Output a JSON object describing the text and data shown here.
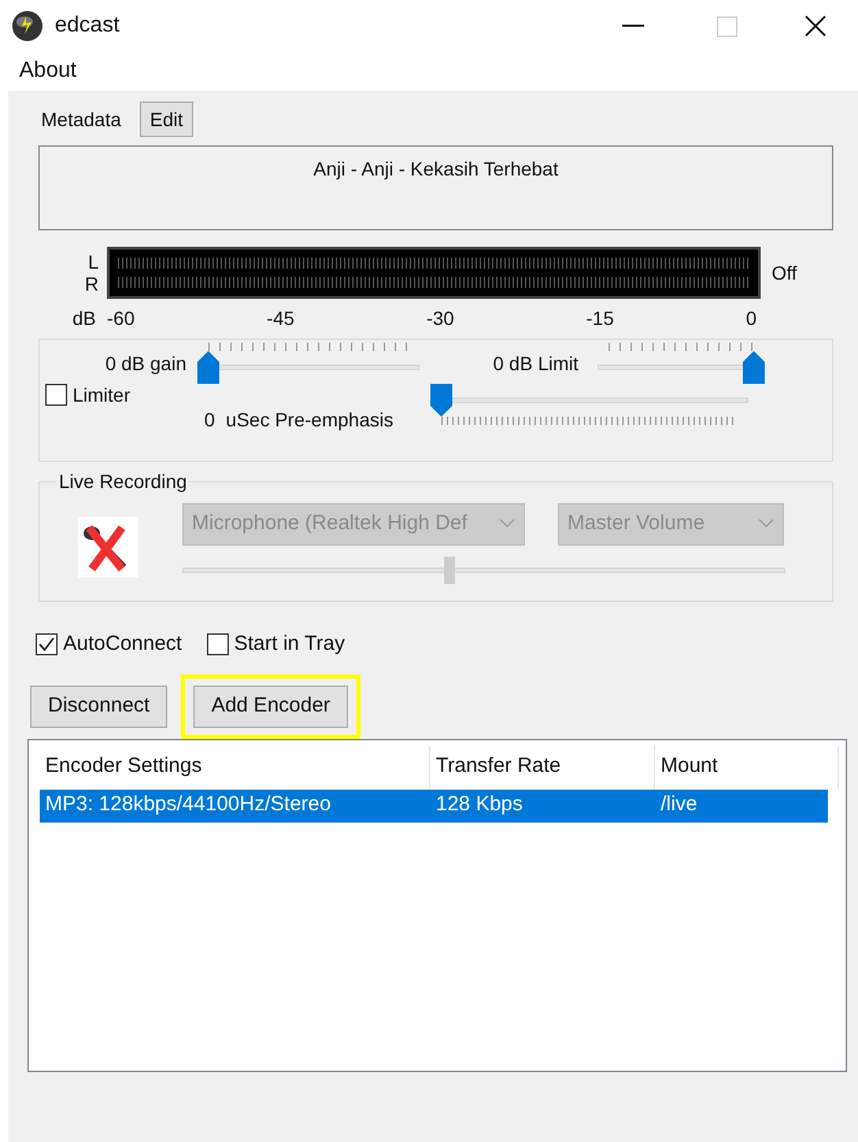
{
  "window": {
    "title": "edcast"
  },
  "menu": [
    "About"
  ],
  "metadata": {
    "label": "Metadata",
    "edit_button": "Edit",
    "value": "Anji - Anji - Kekasih Terhebat"
  },
  "meter": {
    "channels": [
      "L",
      "R"
    ],
    "status": "Off",
    "scale_unit": "dB",
    "scale": [
      "-60",
      "-45",
      "-30",
      "-15",
      "0"
    ]
  },
  "gain": {
    "label": "0 dB gain",
    "level": 0
  },
  "limit": {
    "label": "0 dB Limit",
    "level": 1
  },
  "limiter": {
    "label": "Limiter",
    "checked": false
  },
  "pre_emphasis": {
    "value": "0",
    "label": "uSec Pre-emphasis",
    "level": 0
  },
  "live_recording": {
    "title": "Live Recording",
    "device": "Microphone (Realtek High Def",
    "mixer": "Master Volume",
    "level": 0.44,
    "disabled": true
  },
  "options": [
    {
      "label": "AutoConnect",
      "checked": true
    },
    {
      "label": "Start in Tray",
      "checked": false
    }
  ],
  "buttons": [
    {
      "label": "Disconnect",
      "highlighted": false
    },
    {
      "label": "Add Encoder",
      "highlighted": true
    }
  ],
  "table": {
    "columns": [
      "Encoder Settings",
      "Transfer Rate",
      "Mount"
    ],
    "rows": [
      {
        "cells": [
          "MP3: 128kbps/44100Hz/Stereo",
          "128 Kbps",
          "/live"
        ],
        "selected": true
      }
    ]
  }
}
